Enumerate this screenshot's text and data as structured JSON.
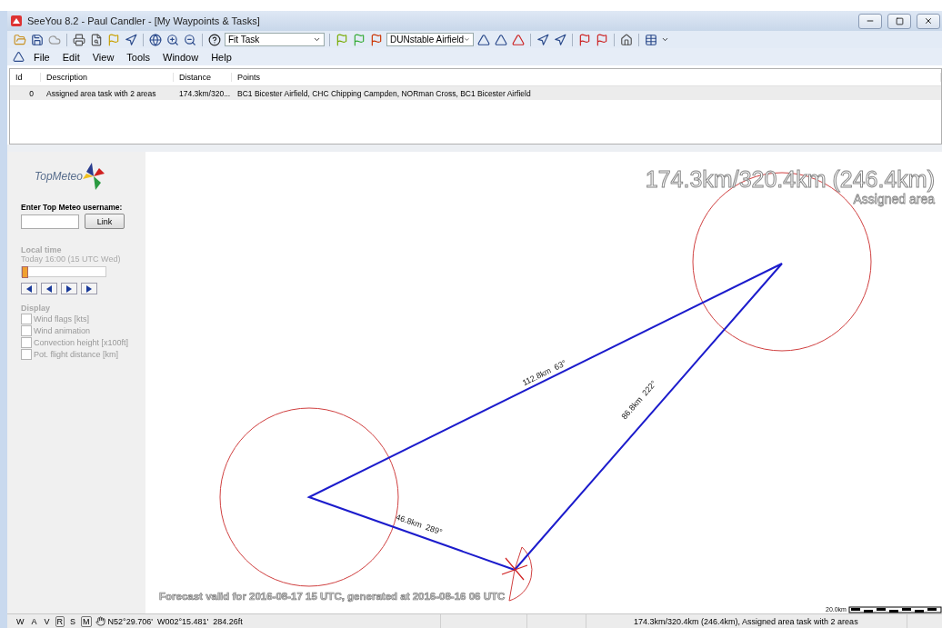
{
  "window": {
    "title": "SeeYou 8.2 - Paul Candler - [My Waypoints & Tasks]"
  },
  "toolbar": {
    "task_select": "Fit Task",
    "waypoint_select": "DUNstable Airfield"
  },
  "menu": [
    "File",
    "Edit",
    "View",
    "Tools",
    "Window",
    "Help"
  ],
  "table": {
    "columns": [
      "Id",
      "Description",
      "Distance",
      "Points"
    ],
    "rows": [
      {
        "cells": [
          "0",
          "Assigned area task with 2 areas",
          "174.3km/320...",
          "BC1 Bicester Airfield, CHC Chipping Campden, NORman Cross, BC1 Bicester Airfield"
        ],
        "selected": true
      }
    ]
  },
  "sidebar": {
    "logo": "TopMeteo",
    "username_label": "Enter Top Meteo username:",
    "link_button": "Link",
    "disabled": true,
    "time_label": "Local time",
    "time_text": "Today 16:00 (15 UTC Wed)",
    "time_slider": {
      "level": 0
    },
    "display_label": "Display",
    "options": [
      {
        "label": "Wind flags [kts]",
        "checked": false
      },
      {
        "label": "Wind animation",
        "checked": false
      },
      {
        "label": "Convection height [x100ft]",
        "checked": false
      },
      {
        "label": "Pot. flight distance [km]",
        "checked": false
      }
    ]
  },
  "map": {
    "summary": "174.3km/320.4km (246.4km)",
    "task_type": "Assigned area",
    "legs": [
      {
        "label": "112.8km  63°"
      },
      {
        "label": "86.8km  222°"
      },
      {
        "label": "46.8km  289°"
      }
    ],
    "forecast": "Forecast valid for 2016-08-17 15 UTC, generated at 2016-08-16 06 UTC",
    "scale": "20.0km"
  },
  "status_bar": {
    "toggles": [
      {
        "label": "W",
        "selected": false
      },
      {
        "label": "A",
        "selected": false
      },
      {
        "label": "V",
        "selected": false
      },
      {
        "label": "R",
        "selected": true
      },
      {
        "label": "S",
        "selected": false
      },
      {
        "label": "M",
        "selected": true
      }
    ],
    "position": "N52°29.706'  W002°15.481'  284.26ft",
    "message": "174.3km/320.4km (246.4km), Assigned area task with 2 areas"
  }
}
